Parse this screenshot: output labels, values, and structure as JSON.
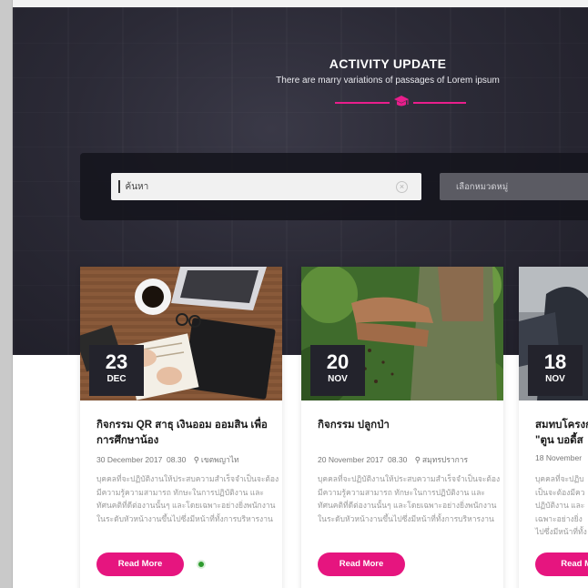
{
  "hero": {
    "title": "ACTIVITY  UPDATE",
    "subtitle": "There are marry variations of passages of Lorem ipsum",
    "accent_color": "#e91e8c",
    "divider_icon": "graduation-cap-icon"
  },
  "search": {
    "placeholder": "ค้นหา",
    "value": "",
    "clear_icon": "close-circle-icon",
    "category_placeholder": "เลือกหมวดหมู่"
  },
  "cards": [
    {
      "day": "23",
      "month": "DEC",
      "title": "กิจกรรม QR สาธุ เงินออม ออมสิน เพื่อการศึกษาน้อง",
      "date": "30 December 2017",
      "time": "08.30",
      "location": "เขตพญาไท",
      "description": "บุคคลที่จะปฏิบัติงานให้ประสบความสำเร็จจำเป็นจะต้องมีความรู้ความสามารถ ทักษะในการปฏิบัติงาน และทัศนคติที่ดีต่องานนั้นๆ และโดยเฉพาะอย่างยิ่งพนักงานในระดับหัวหน้างานขึ้นไปซึ่งมีหน้าที่ทั้งการบริหารงาน",
      "button": "Read More",
      "photo_icon": "desk-workspace-photo"
    },
    {
      "day": "20",
      "month": "NOV",
      "title": "กิจกรรม ปลูกป่า",
      "date": "20 November 2017",
      "time": "08.30",
      "location": "สมุทรปราการ",
      "description": "บุคคลที่จะปฏิบัติงานให้ประสบความสำเร็จจำเป็นจะต้องมีความรู้ความสามารถ ทักษะในการปฏิบัติงาน และทัศนคติที่ดีต่องานนั้นๆ และโดยเฉพาะอย่างยิ่งพนักงานในระดับหัวหน้างานขึ้นไปซึ่งมีหน้าที่ทั้งการบริหารงาน",
      "button": "Read More",
      "photo_icon": "hands-soil-photo"
    },
    {
      "day": "18",
      "month": "NOV",
      "title": "สมทบโครงก \"ตูน บอดี้ส",
      "date": "18 November",
      "time": "",
      "location": "",
      "description": "บุคคลที่จะปฏิบ เป็นจะต้องมีคว ปฏิบัติงาน และ เฉพาะอย่างยิ่ง ไปซึ่งมีหน้าที่ทั้ง",
      "button": "Read Mo",
      "photo_icon": "runner-photo"
    }
  ]
}
